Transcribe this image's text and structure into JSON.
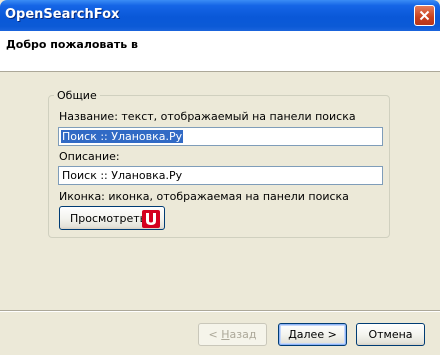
{
  "window": {
    "title": "OpenSearchFox"
  },
  "header": {
    "title": "Добро пожаловать в"
  },
  "group": {
    "legend": "Общие",
    "name_label": "Название: текст, отображаемый на панели поиска",
    "name_value": "Поиск :: Улановка.Ру",
    "description_label": "Описание:",
    "description_value": "Поиск :: Улановка.Ру",
    "icon_label": "Иконка: иконка, отображаемая на панели поиска",
    "preview_button": "Просмотреть",
    "icon_name": "ulanovka-logo-icon",
    "icon_color": "#d4001f"
  },
  "footer": {
    "back_accel": "Н",
    "back_rest": "азад",
    "back_prefix": "< ",
    "next_accel": "Д",
    "next_rest": "алее",
    "next_suffix": " >",
    "cancel": "Отмена"
  }
}
